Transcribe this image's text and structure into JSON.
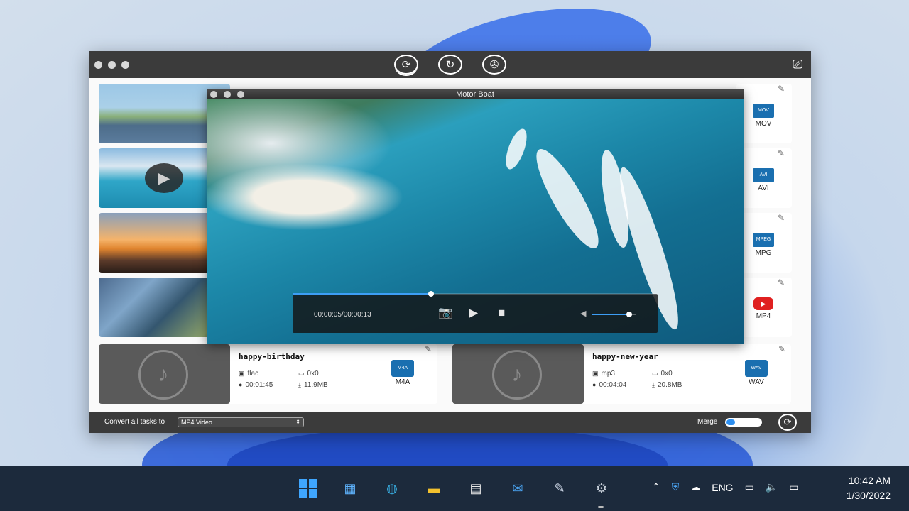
{
  "window": {
    "top_icons": [
      "convert-icon",
      "repair-icon",
      "reel-icon"
    ],
    "top_right_icon": "media-library-icon"
  },
  "side_formats": [
    {
      "label": "MOV",
      "icon": "MOV"
    },
    {
      "label": "AVI",
      "icon": "AVI"
    },
    {
      "label": "MPG",
      "icon": "MPEG"
    },
    {
      "label": "MP4",
      "icon": "youtube-icon"
    }
  ],
  "audio_tasks": [
    {
      "name": "happy-birthday",
      "codec": "flac",
      "resolution": "0x0",
      "duration": "00:01:45",
      "size": "11.9MB",
      "format": "M4A",
      "format_icon": "M4A"
    },
    {
      "name": "happy-new-year",
      "codec": "mp3",
      "resolution": "0x0",
      "duration": "00:04:04",
      "size": "20.8MB",
      "format": "WAV",
      "format_icon": "WAV"
    }
  ],
  "bottom": {
    "convert_label": "Convert all tasks to",
    "convert_value": "MP4 Video",
    "merge_label": "Merge",
    "merge_on": true
  },
  "player": {
    "title": "Motor Boat",
    "time": "00:00:05/00:00:13",
    "progress": 0.38,
    "volume": 0.85
  },
  "taskbar": {
    "apps": [
      "start",
      "widgets",
      "edge",
      "file-explorer",
      "store",
      "mail",
      "paint",
      "settings"
    ],
    "language": "ENG",
    "time": "10:42 AM",
    "date": "1/30/2022"
  },
  "colors": {
    "accent": "#3d9ef5",
    "window_bar": "#3b3b3b",
    "taskbar": "#1c2a3c"
  }
}
